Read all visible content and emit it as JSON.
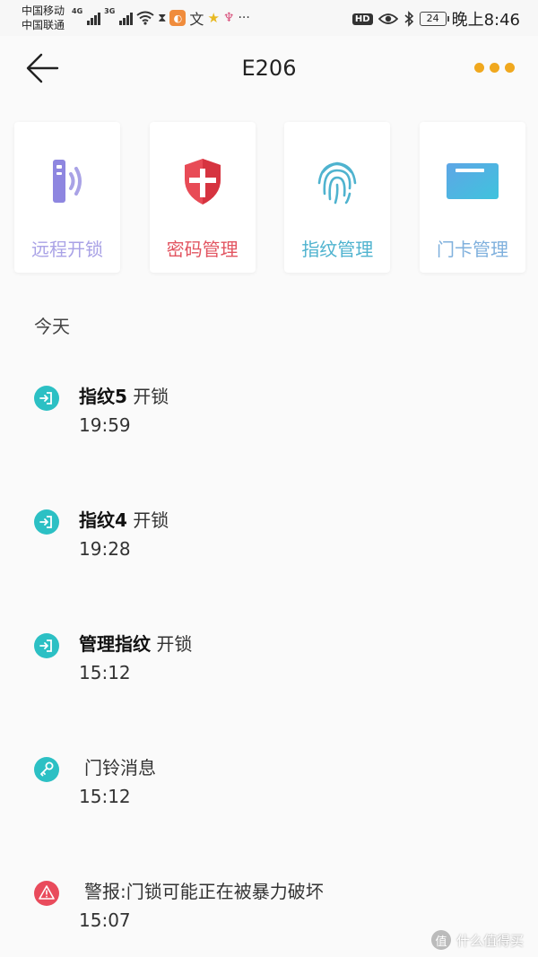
{
  "status_bar": {
    "carrier_1": "中国移动",
    "carrier_2": "中国联通",
    "network_1": "4G",
    "network_2": "3G",
    "hd": "HD",
    "battery": "24",
    "time": "晚上8:46",
    "app_icons": [
      "signal-icon",
      "wifi-icon",
      "hourglass-icon",
      "browser-icon",
      "translate-icon",
      "star-icon",
      "app-icon",
      "more-icon"
    ]
  },
  "nav": {
    "title": "E206",
    "more_color": "#f0a81e"
  },
  "tiles": [
    {
      "label": "远程开锁",
      "color": "#a9a2e6",
      "icon": "remote-unlock-icon"
    },
    {
      "label": "密码管理",
      "color": "#e25561",
      "icon": "shield-icon"
    },
    {
      "label": "指纹管理",
      "color": "#4fb3cf",
      "icon": "fingerprint-icon"
    },
    {
      "label": "门卡管理",
      "color": "#7fb0dd",
      "icon": "card-icon"
    }
  ],
  "section": {
    "today": "今天"
  },
  "records": [
    {
      "bold": "指纹5",
      "text": " 开锁",
      "time": "19:59",
      "icon": "unlock-icon",
      "color": "#2cc0c4"
    },
    {
      "bold": "指纹4",
      "text": " 开锁",
      "time": "19:28",
      "icon": "unlock-icon",
      "color": "#2cc0c4"
    },
    {
      "bold": "管理指纹",
      "text": " 开锁",
      "time": "15:12",
      "icon": "unlock-icon",
      "color": "#2cc0c4"
    },
    {
      "bold": "",
      "text": "门铃消息",
      "time": "15:12",
      "icon": "doorbell-icon",
      "color": "#2cc0c4"
    },
    {
      "bold": "",
      "text": "警报:门锁可能正在被暴力破坏",
      "time": "15:07",
      "icon": "alert-icon",
      "color": "#e94b5c"
    }
  ],
  "watermark": {
    "badge": "值",
    "text": "什么值得买"
  }
}
